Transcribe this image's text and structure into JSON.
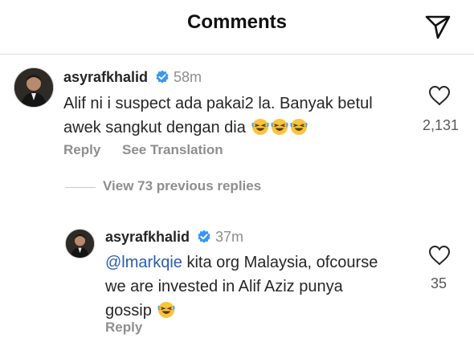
{
  "header": {
    "title": "Comments",
    "send_icon": "paper-plane-icon"
  },
  "comment": {
    "username": "asyrafkhalid",
    "verified_icon": "verified-badge-icon",
    "time": "58m",
    "text_line1": "Alif ni i suspect ada pakai2 la. Banyak betul",
    "text_line2": "awek sangkut dengan dia",
    "emoji": "rolling-on-floor-laughing-emoji",
    "likes": "2,131",
    "reply_label": "Reply",
    "translate_label": "See Translation"
  },
  "view_replies": "View 73 previous replies",
  "reply": {
    "username": "asyrafkhalid",
    "time": "37m",
    "mention": "@lmarkqie",
    "text_line1_rest": " kita org Malaysia, ofcourse",
    "text_line2": "we are invested in Alif Aziz punya",
    "text_line3": "gossip",
    "likes": "35",
    "reply_label": "Reply"
  },
  "colors": {
    "verified": "#3897f0",
    "emoji": "#f9c33c",
    "mention": "#2a5db0"
  }
}
